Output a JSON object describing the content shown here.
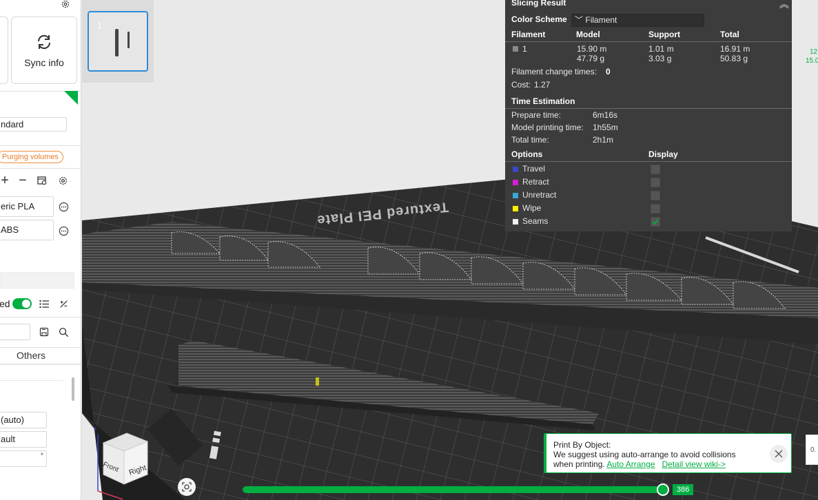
{
  "sidebar": {
    "sync_label": "Sync info",
    "plate_type_value": "ndard",
    "purge_label": "Purging volumes",
    "filaments": [
      "eric PLA",
      "ABS"
    ],
    "toggle_label": "ed",
    "tab_others": "Others",
    "field_auto": "(auto)",
    "field_default": "ault",
    "field_unit": "°"
  },
  "thumbnail": {
    "plate_number": "1"
  },
  "slicing_result": {
    "title": "Slicing Result",
    "color_scheme_label": "Color Scheme",
    "color_scheme_value": "Filament",
    "columns": [
      "Filament",
      "Model",
      "Support",
      "Total"
    ],
    "filament_row": {
      "id": "1",
      "model_length": "15.90 m",
      "model_weight": "47.79 g",
      "support_length": "1.01 m",
      "support_weight": "3.03 g",
      "total_length": "16.91 m",
      "total_weight": "50.83 g"
    },
    "filament_change_label": "Filament change times:",
    "filament_change_value": "0",
    "cost_label": "Cost:",
    "cost_value": "1.27",
    "time_title": "Time Estimation",
    "prepare_label": "Prepare time:",
    "prepare_value": "6m16s",
    "model_time_label": "Model printing time:",
    "model_time_value": "1h55m",
    "total_time_label": "Total time:",
    "total_time_value": "2h1m",
    "options_header": "Options",
    "display_header": "Display",
    "options": [
      {
        "label": "Travel",
        "color": "#3a48c8",
        "checked": false
      },
      {
        "label": "Retract",
        "color": "#d420d4",
        "checked": false
      },
      {
        "label": "Unretract",
        "color": "#3aa6d8",
        "checked": false
      },
      {
        "label": "Wipe",
        "color": "#ffee00",
        "checked": false
      },
      {
        "label": "Seams",
        "color": "#f0f0f0",
        "checked": true
      }
    ]
  },
  "plate_label": "Textured PEI Plate",
  "view_cube": {
    "front": "Front",
    "right": "Right"
  },
  "notification": {
    "title": "Print By Object:",
    "line1": "We suggest using auto-arrange to avoid collisions",
    "line2_prefix": "when printing.",
    "link_arrange": "Auto Arrange",
    "link_wiki": "Detail view wiki->"
  },
  "layer_slider": {
    "value": "386"
  },
  "side_values": {
    "top_a": "12",
    "top_b": "15.0",
    "bottom": "0."
  },
  "colors": {
    "accent": "#00ae42",
    "panel_bg": "#3c3c3c",
    "viewport_bg": "#e9e9e9"
  }
}
